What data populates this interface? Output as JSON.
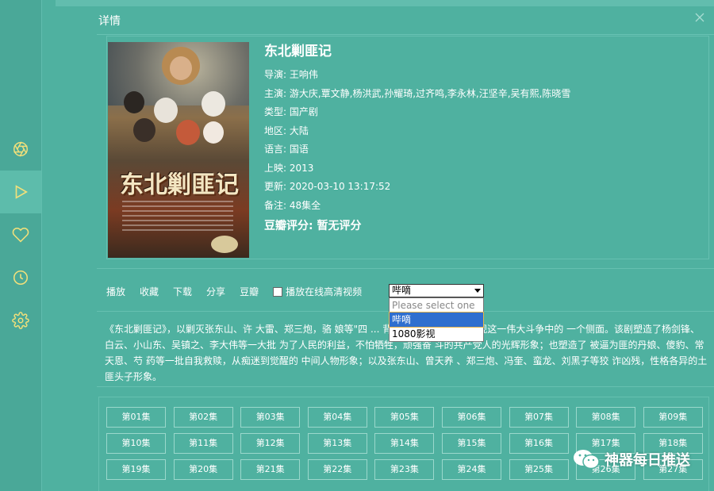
{
  "dialog": {
    "title": "详情"
  },
  "movie": {
    "title": "东北剿匪记",
    "poster_title": "东北剿匪记",
    "fields": [
      "导演: 王响伟",
      "主演: 游大庆,覃文静,杨洪武,孙耀琦,过齐鸣,李永林,汪坚辛,吴有熙,陈晓雪",
      "类型: 国产剧",
      "地区: 大陆",
      "语言: 国语",
      "上映: 2013",
      "更新: 2020-03-10 13:17:52",
      "备注: 48集全"
    ],
    "rating": "豆瓣评分: 暂无评分"
  },
  "actions": {
    "play": "播放",
    "favorite": "收藏",
    "download": "下载",
    "share": "分享",
    "douban": "豆瓣",
    "hd_checkbox_label": "播放在线高清视频"
  },
  "source_select": {
    "value": "哔嘀",
    "options": [
      "Please select one",
      "哔嘀",
      "1080影视"
    ]
  },
  "description": "《东北剿匪记》，以剿灭张东山、许 大雷、郑三炮，骆 娘等\"四 ... 背景，力求艺术性地展现这一伟大斗争中的 一个侧面。该剧塑造了杨剑锋、白云、小山东、吴镇之、李大伟等一大批 为了人民的利益，不怕牺牲，顽强奋 斗的共产党人的光辉形象；也塑造了 被逼为匪的丹娘、傻豹、常天恩、芍 药等一批自我救赎，从痴迷到觉醒的 中间人物形象；以及张东山、曾天养 、郑三炮、冯奎、蛮龙、刘黑子等狡 诈凶残，性格各异的土匪头子形象。",
  "episodes": [
    "第01集",
    "第02集",
    "第03集",
    "第04集",
    "第05集",
    "第06集",
    "第07集",
    "第08集",
    "第09集",
    "第10集",
    "第11集",
    "第12集",
    "第13集",
    "第14集",
    "第15集",
    "第16集",
    "第17集",
    "第18集",
    "第19集",
    "第20集",
    "第21集",
    "第22集",
    "第23集",
    "第24集",
    "第25集",
    "第26集",
    "第27集"
  ],
  "watermark": "神器每日推送",
  "colors": {
    "background": "#4fb1a0",
    "sidebar": "#4aa898",
    "accent_yellow": "#f2e07a"
  }
}
